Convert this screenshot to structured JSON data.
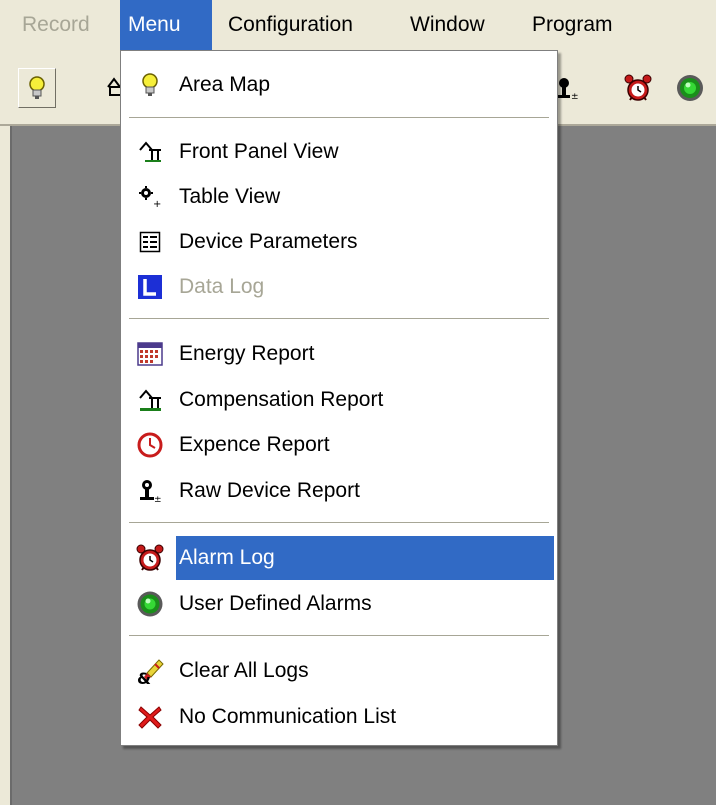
{
  "menubar": {
    "items": [
      {
        "label": "Record"
      },
      {
        "label": "Menu"
      },
      {
        "label": "Configuration"
      },
      {
        "label": "Window"
      },
      {
        "label": "Program"
      }
    ]
  },
  "menu": {
    "items": [
      {
        "label": "Area Map",
        "icon": "lightbulb-icon"
      },
      {
        "label": "Front Panel View",
        "icon": "front-panel-icon"
      },
      {
        "label": "Table View",
        "icon": "table-view-icon"
      },
      {
        "label": "Device Parameters",
        "icon": "device-parameters-icon"
      },
      {
        "label": "Data Log",
        "icon": "data-log-icon",
        "disabled": true
      },
      {
        "label": "Energy Report",
        "icon": "calendar-icon"
      },
      {
        "label": "Compensation Report",
        "icon": "compensation-icon"
      },
      {
        "label": "Expence Report",
        "icon": "clock-icon"
      },
      {
        "label": "Raw Device Report",
        "icon": "raw-device-icon"
      },
      {
        "label": "Alarm Log",
        "icon": "alarm-clock-icon",
        "highlighted": true
      },
      {
        "label": "User Defined Alarms",
        "icon": "green-alarm-icon"
      },
      {
        "label": "Clear All Logs",
        "icon": "eraser-icon"
      },
      {
        "label": "No Communication List",
        "icon": "red-x-icon"
      }
    ]
  },
  "colors": {
    "highlight": "#316ac5",
    "menubar_bg": "#ece9d8",
    "workspace": "#808080",
    "disabled_text": "#a7a696"
  }
}
